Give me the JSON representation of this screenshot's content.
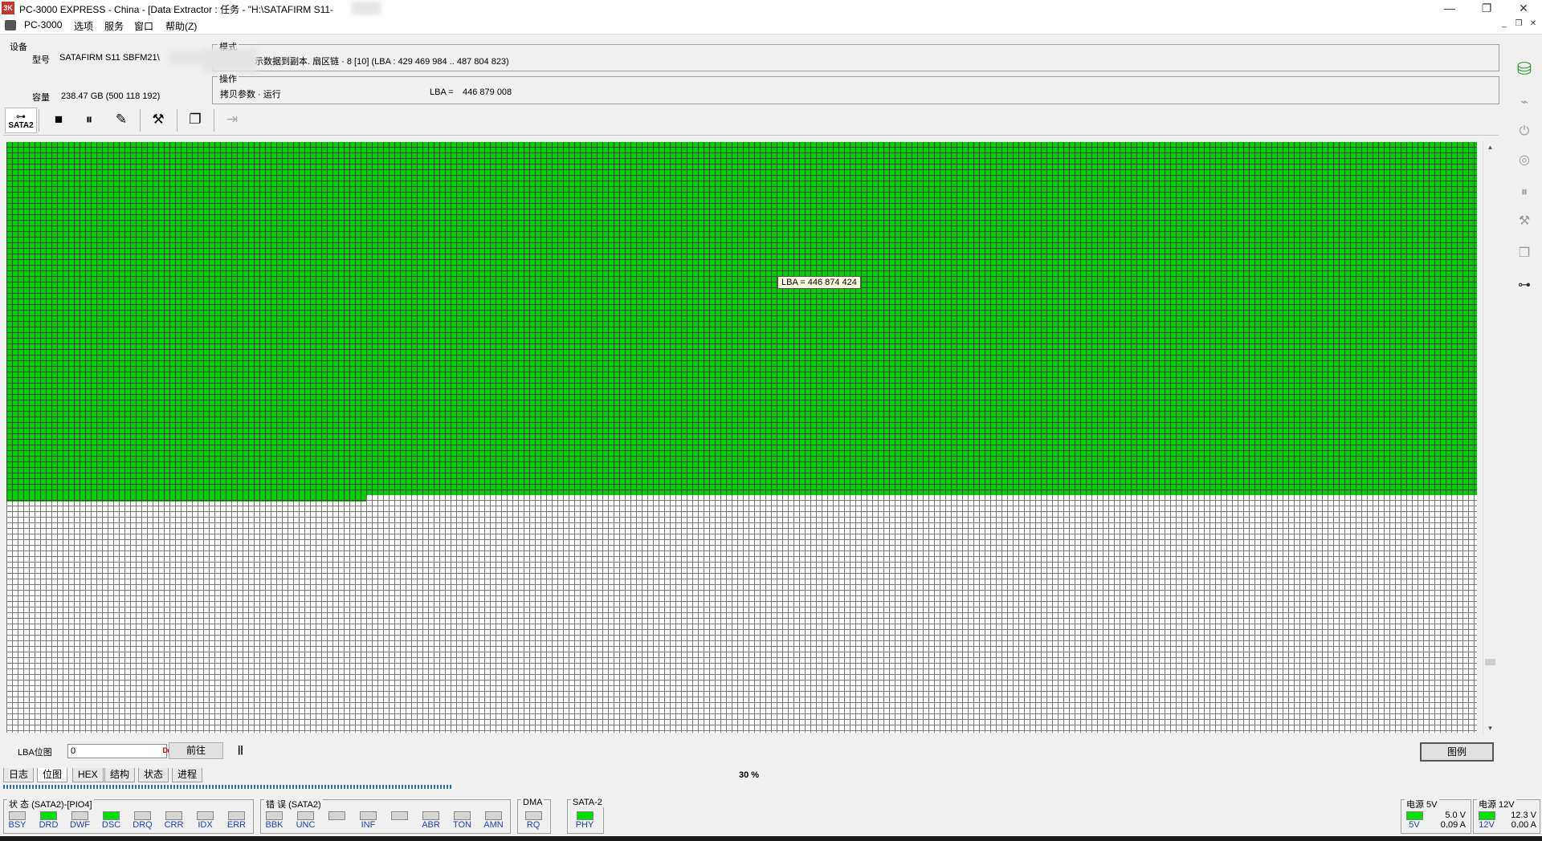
{
  "window": {
    "logo": "3K",
    "title": "PC-3000 EXPRESS - China - [Data Extractor : 任务 - \"H:\\SATAFIRM   S11-",
    "minimize": "—",
    "restore": "❐",
    "close": "✕"
  },
  "menu": {
    "items": [
      "PC-3000",
      "选项",
      "服务",
      "窗口",
      "帮助(Z)"
    ]
  },
  "device_panel": {
    "group_label": "设备",
    "model_label": "型号",
    "model_value": "SATAFIRM   S11 SBFM21\\",
    "capacity_label": "容量",
    "capacity_value": "238.47 GB (500 118 192)"
  },
  "mode_panel": {
    "group_label": "模式",
    "mode_value": "示数据到副本. 扇区链 · 8 [10] (LBA : 429 469 984 .. 487 804 823)",
    "operation_label": "操作",
    "operation_value": "拷贝参数 · 运行",
    "lba_label": "LBA =",
    "lba_value": "446 879 008"
  },
  "toolbar": {
    "sata_label": "SATA2"
  },
  "map": {
    "tooltip_label": "LBA =",
    "tooltip_value": "446 874 424",
    "colors": {
      "read_ok": "#00d000",
      "pending": "#ffffff",
      "grid": "#444444"
    },
    "progress_percent": 30
  },
  "controls": {
    "lba_map_label": "LBA位图",
    "lba_input_value": "0",
    "go_button": "前往",
    "pause_icon": "||",
    "legend_button": "图例"
  },
  "tabs": [
    "日志",
    "位图",
    "HEX",
    "结构",
    "状态",
    "进程"
  ],
  "active_tab": "位图",
  "progress_text": "30 %",
  "status": {
    "state_group": "状 态 (SATA2)-[PIO4]",
    "state_leds": [
      {
        "label": "BSY",
        "on": false
      },
      {
        "label": "DRD",
        "on": true
      },
      {
        "label": "DWF",
        "on": false
      },
      {
        "label": "DSC",
        "on": true
      },
      {
        "label": "DRQ",
        "on": false
      },
      {
        "label": "CRR",
        "on": false
      },
      {
        "label": "IDX",
        "on": false
      },
      {
        "label": "ERR",
        "on": false
      }
    ],
    "error_group": "错 误 (SATA2)",
    "error_leds": [
      {
        "label": "BBK",
        "on": false
      },
      {
        "label": "UNC",
        "on": false
      },
      {
        "label": "",
        "on": false
      },
      {
        "label": "INF",
        "on": false
      },
      {
        "label": "",
        "on": false
      },
      {
        "label": "ABR",
        "on": false
      },
      {
        "label": "TON",
        "on": false
      },
      {
        "label": "AMN",
        "on": false
      }
    ],
    "dma_group": "DMA",
    "dma_led": {
      "label": "RQ",
      "on": false
    },
    "sata_group": "SATA-2",
    "sata_led": {
      "label": "PHY",
      "on": true
    },
    "power5_group": "电源 5V",
    "power5_led": {
      "label": "5V",
      "on": true
    },
    "power5_voltage": "5.0 V",
    "power5_current": "0.09 A",
    "power12_group": "电源 12V",
    "power12_led": {
      "label": "12V",
      "on": true
    },
    "power12_voltage": "12.3 V",
    "power12_current": "0.00 A"
  }
}
